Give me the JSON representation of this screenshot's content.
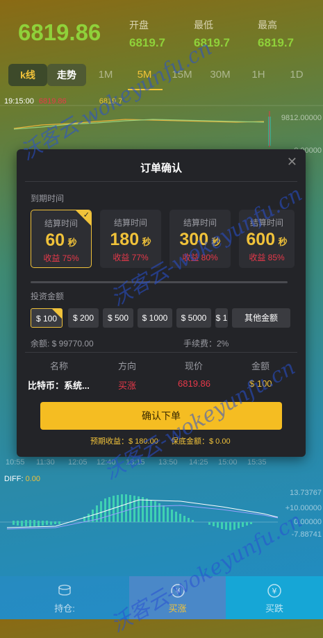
{
  "header": {
    "price": "6819.86",
    "stats": [
      {
        "label": "开盘",
        "value": "6819.7"
      },
      {
        "label": "最低",
        "value": "6819.7"
      },
      {
        "label": "最高",
        "value": "6819.7"
      }
    ]
  },
  "tabs": {
    "kline": "k线",
    "trend": "走势",
    "intervals": [
      "1M",
      "5M",
      "15M",
      "30M",
      "1H",
      "1D"
    ],
    "active_interval": "5M"
  },
  "chart": {
    "info_time": "19:15:00",
    "info_v1": "6819.86",
    "info_v2": "6819.7",
    "right_top": "9812.00000",
    "right_mid": "0.00000",
    "time_ticks": [
      "10:55",
      "11:30",
      "12:05",
      "12:40",
      "13:15",
      "13:50",
      "14:25",
      "15:00",
      "15:35"
    ],
    "diff_label": "DIFF:",
    "diff_value": "0.00",
    "diff_axis": [
      "13.73767",
      "+10.00000",
      "0.00000",
      "-7.88741"
    ]
  },
  "modal": {
    "title": "订单确认",
    "expire_label": "到期时间",
    "cards": [
      {
        "title": "结算时间",
        "num": "60",
        "unit": "秒",
        "profit": "收益 75%"
      },
      {
        "title": "结算时间",
        "num": "180",
        "unit": "秒",
        "profit": "收益 77%"
      },
      {
        "title": "结算时间",
        "num": "300",
        "unit": "秒",
        "profit": "收益 80%"
      },
      {
        "title": "结算时间",
        "num": "600",
        "unit": "秒",
        "profit": "收益 85%"
      }
    ],
    "invest_label": "投资金额",
    "amounts": [
      "$ 100",
      "$ 200",
      "$ 500",
      "$ 1000",
      "$ 5000",
      "$ 1"
    ],
    "other_amount": "其他金额",
    "balance": "余额: $ 99770.00",
    "fee": "手续费：2%",
    "table_headers": [
      "名称",
      "方向",
      "现价",
      "金额"
    ],
    "row": {
      "name": "比特币：系统...",
      "dir": "买涨",
      "price": "6819.86",
      "amount": "$ 100"
    },
    "confirm": "确认下单",
    "expected": "预期收益：$ 180.00",
    "margin": "保底金额：$ 0.00"
  },
  "bottom": {
    "position": "持仓:",
    "buy_up": "买涨",
    "buy_down": "买跌"
  },
  "watermark": "沃客云-wokeyunfu.cn",
  "colors": {
    "up": "#8fd13a",
    "accent": "#f0c23a",
    "down": "#e8394a"
  }
}
